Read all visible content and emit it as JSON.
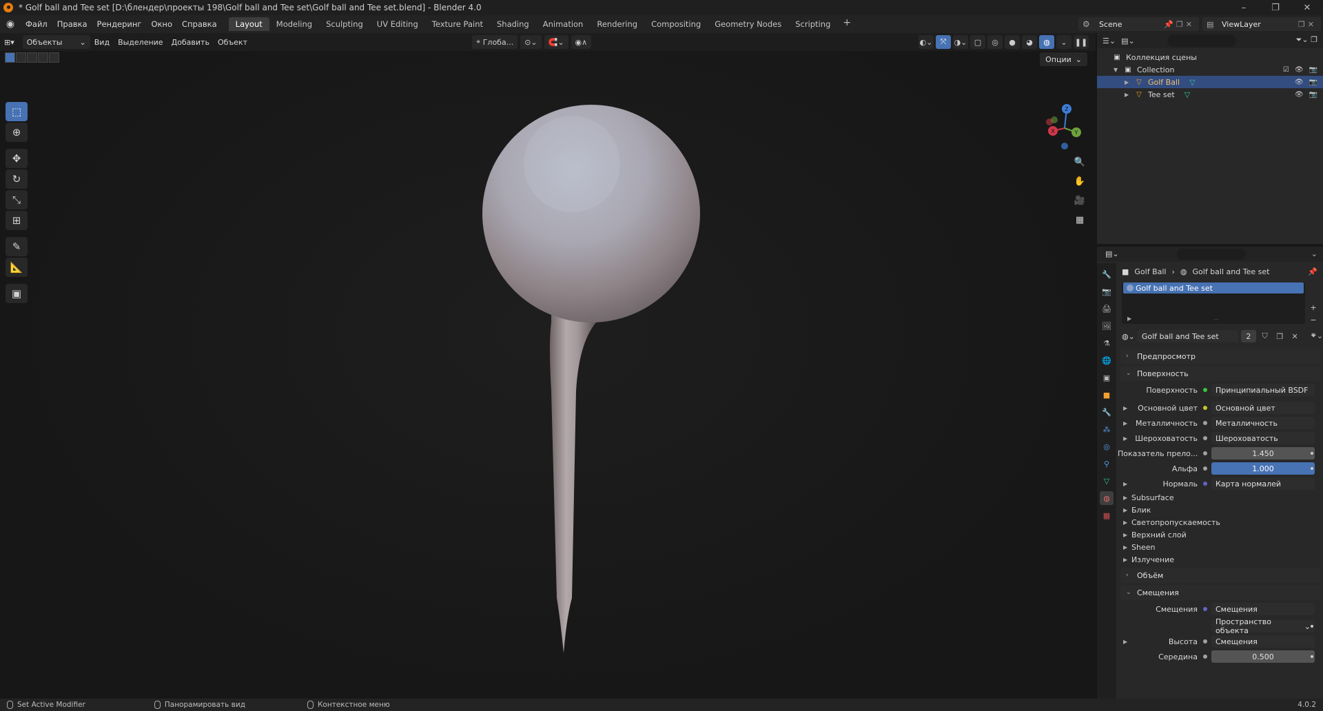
{
  "window": {
    "title": "* Golf ball and Tee set [D:\\блендер\\проекты 198\\Golf ball and Tee set\\Golf ball and Tee set.blend] - Blender 4.0",
    "controls": [
      "–",
      "❐",
      "✕"
    ]
  },
  "menu": {
    "items": [
      "Файл",
      "Правка",
      "Рендеринг",
      "Окно",
      "Справка"
    ]
  },
  "workspaces": {
    "tabs": [
      "Layout",
      "Modeling",
      "Sculpting",
      "UV Editing",
      "Texture Paint",
      "Shading",
      "Animation",
      "Rendering",
      "Compositing",
      "Geometry Nodes",
      "Scripting"
    ],
    "active": "Layout",
    "add": "+"
  },
  "scene": {
    "name": "Scene"
  },
  "view_layer": {
    "name": "ViewLayer"
  },
  "viewport": {
    "mode": "Объекты",
    "menus": [
      "Вид",
      "Выделение",
      "Добавить",
      "Объект"
    ],
    "transform_orientation": "Глоба...",
    "options_label": "Опции"
  },
  "gizmo": {
    "axes": [
      "X",
      "Y",
      "Z"
    ]
  },
  "outliner": {
    "root": "Коллекция сцены",
    "collection": "Collection",
    "objects": [
      {
        "name": "Golf Ball",
        "selected": true
      },
      {
        "name": "Tee set",
        "selected": false
      }
    ]
  },
  "properties": {
    "breadcrumb": {
      "object": "Golf Ball",
      "material": "Golf ball and Tee set"
    },
    "material_slot": "Golf ball and Tee set",
    "material_name": "Golf ball and Tee set",
    "user_count": "2",
    "panels": {
      "preview": "Предпросмотр",
      "surface": "Поверхность",
      "volume": "Объём",
      "displacement": "Смещения"
    },
    "surface_rows": [
      {
        "label": "Поверхность",
        "value": "Принципиальный BSDF",
        "socket": "#3cc23c",
        "expand": false,
        "numeric": false
      },
      {
        "label": "Основной цвет",
        "value": "Основной цвет",
        "socket": "#c7c729",
        "expand": true,
        "numeric": false
      },
      {
        "label": "Металличность",
        "value": "Металличность",
        "socket": "#a1a1a1",
        "expand": true,
        "numeric": false
      },
      {
        "label": "Шероховатость",
        "value": "Шероховатость",
        "socket": "#a1a1a1",
        "expand": true,
        "numeric": false
      },
      {
        "label": "Показатель прело...",
        "value": "1.450",
        "socket": "#a1a1a1",
        "expand": false,
        "numeric": true
      },
      {
        "label": "Альфа",
        "value": "1.000",
        "socket": "#a1a1a1",
        "expand": false,
        "numeric": true,
        "highlight": true
      },
      {
        "label": "Нормаль",
        "value": "Карта нормалей",
        "socket": "#6363c7",
        "expand": true,
        "numeric": false
      }
    ],
    "subsections": [
      "Subsurface",
      "Блик",
      "Светопропускаемость",
      "Верхний слой",
      "Sheen",
      "Излучение"
    ],
    "displacement_rows": [
      {
        "label": "Смещения",
        "value": "Смещения",
        "socket": "#6363c7"
      },
      {
        "label": "",
        "value": "Пространство объекта",
        "socket": ""
      },
      {
        "label": "Высота",
        "value": "Смещения",
        "socket": "#a1a1a1"
      },
      {
        "label": "Середина",
        "value": "0.500",
        "socket": "#a1a1a1"
      }
    ]
  },
  "statusbar": {
    "left": "Set Active Modifier",
    "middle": "Панорамировать вид",
    "right": "Контекстное меню",
    "version": "4.0.2"
  },
  "colors": {
    "accent": "#4772b3",
    "selection": "#334d80",
    "brand": "#e87d0d"
  }
}
